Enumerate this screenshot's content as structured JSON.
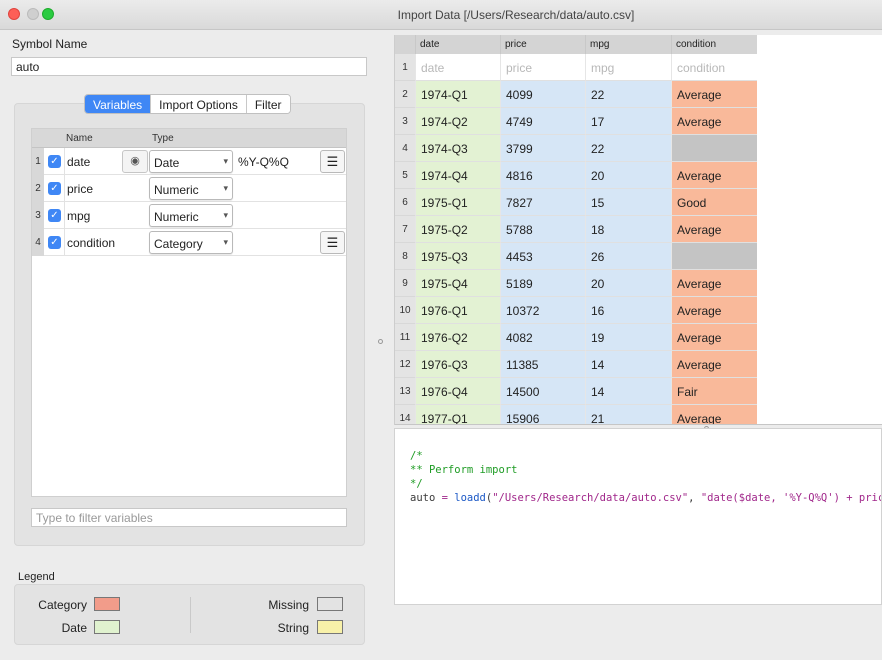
{
  "window": {
    "title": "Import Data [/Users/Research/data/auto.csv]"
  },
  "symbol": {
    "label": "Symbol Name",
    "value": "auto"
  },
  "tabs": [
    {
      "label": "Variables",
      "active": true
    },
    {
      "label": "Import Options",
      "active": false
    },
    {
      "label": "Filter",
      "active": false
    }
  ],
  "variables": {
    "headers": {
      "name": "Name",
      "type": "Type"
    },
    "rows": [
      {
        "num": "1",
        "checked": true,
        "name": "date",
        "type": "Date",
        "format": "%Y-Q%Q",
        "has_eye": true,
        "has_menu": true
      },
      {
        "num": "2",
        "checked": true,
        "name": "price",
        "type": "Numeric",
        "format": "",
        "has_eye": false,
        "has_menu": false
      },
      {
        "num": "3",
        "checked": true,
        "name": "mpg",
        "type": "Numeric",
        "format": "",
        "has_eye": false,
        "has_menu": false
      },
      {
        "num": "4",
        "checked": true,
        "name": "condition",
        "type": "Category",
        "format": "",
        "has_eye": false,
        "has_menu": true
      }
    ],
    "filter_placeholder": "Type to filter variables"
  },
  "legend": {
    "title": "Legend",
    "items": [
      {
        "label": "Category",
        "color": "#f29c8a"
      },
      {
        "label": "Date",
        "color": "#e0f2cf"
      },
      {
        "label": "Missing",
        "color": "#e3e3e3"
      },
      {
        "label": "String",
        "color": "#f8f1a9"
      }
    ]
  },
  "grid": {
    "columns": [
      "date",
      "price",
      "mpg",
      "condition"
    ],
    "header_row": {
      "num": "1",
      "cells": [
        "date",
        "price",
        "mpg",
        "condition"
      ]
    },
    "rows": [
      {
        "num": "2",
        "cells": [
          "1974-Q1",
          "4099",
          "22",
          "Average"
        ]
      },
      {
        "num": "3",
        "cells": [
          "1974-Q2",
          "4749",
          "17",
          "Average"
        ]
      },
      {
        "num": "4",
        "cells": [
          "1974-Q3",
          "3799",
          "22",
          ""
        ]
      },
      {
        "num": "5",
        "cells": [
          "1974-Q4",
          "4816",
          "20",
          "Average"
        ]
      },
      {
        "num": "6",
        "cells": [
          "1975-Q1",
          "7827",
          "15",
          "Good"
        ]
      },
      {
        "num": "7",
        "cells": [
          "1975-Q2",
          "5788",
          "18",
          "Average"
        ]
      },
      {
        "num": "8",
        "cells": [
          "1975-Q3",
          "4453",
          "26",
          ""
        ]
      },
      {
        "num": "9",
        "cells": [
          "1975-Q4",
          "5189",
          "20",
          "Average"
        ]
      },
      {
        "num": "10",
        "cells": [
          "1976-Q1",
          "10372",
          "16",
          "Average"
        ]
      },
      {
        "num": "11",
        "cells": [
          "1976-Q2",
          "4082",
          "19",
          "Average"
        ]
      },
      {
        "num": "12",
        "cells": [
          "1976-Q3",
          "11385",
          "14",
          "Average"
        ]
      },
      {
        "num": "13",
        "cells": [
          "1976-Q4",
          "14500",
          "14",
          "Fair"
        ]
      },
      {
        "num": "14",
        "cells": [
          "1977-Q1",
          "15906",
          "21",
          "Average"
        ]
      }
    ]
  },
  "code": {
    "comment_open": "/*",
    "comment_body": "** Perform import",
    "comment_close": "*/",
    "var": "auto",
    "op": " = ",
    "fn": "loadd",
    "paren_open": "(",
    "arg1": "\"/Users/Research/data/auto.csv\"",
    "comma": ", ",
    "arg2": "\"date($date, '%Y-Q%Q') + price +"
  }
}
